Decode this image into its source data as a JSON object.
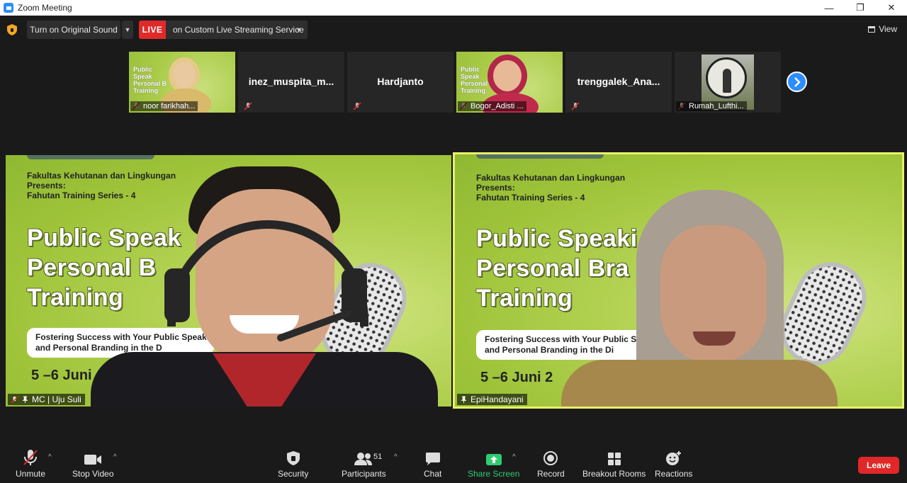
{
  "window": {
    "title": "Zoom Meeting",
    "controls": {
      "minimize": "—",
      "restore": "❐",
      "close": "✕"
    }
  },
  "topbar": {
    "sound_label": "Turn on Original Sound",
    "live_badge": "LIVE",
    "live_text": "on Custom Live Streaming Service",
    "view_label": "View"
  },
  "thumbnails": [
    {
      "name": "noor farikhah...",
      "type": "video"
    },
    {
      "name": "inez_muspita_m...",
      "type": "name"
    },
    {
      "name": "Hardjanto",
      "type": "name"
    },
    {
      "name": "Bogor_Adisti ...",
      "type": "video"
    },
    {
      "name": "trenggalek_Ana...",
      "type": "name"
    },
    {
      "name": "Rumah_Lufthi...",
      "type": "photo"
    }
  ],
  "slide": {
    "header_line1": "Fakultas Kehutanan dan Lingkungan",
    "header_line2": "Presents:",
    "header_line3": "Fahutan Training Series - 4",
    "mini_title": "Public Speak Personal B Training",
    "left_big1": "Public Speak",
    "left_big2": "Personal B",
    "left_big3": "Training",
    "left_bubble1": "Fostering Success with Your Public Speak",
    "left_bubble2": "and Personal Branding in the D",
    "left_date": "5 –6 Juni",
    "right_big1": "Public Speaki",
    "right_big2": "Personal Bra",
    "right_big3": "Training",
    "right_bubble1": "Fostering Success with Your Public Spe",
    "right_bubble2": "and Personal Branding in the Di",
    "right_date": "5 –6 Juni 2"
  },
  "tiles": {
    "left_name": "MC | Uju Suli",
    "right_name": "EpiHandayani"
  },
  "toolbar": {
    "unmute": "Unmute",
    "stop_video": "Stop Video",
    "security": "Security",
    "participants": "Participants",
    "participants_count": "51",
    "chat": "Chat",
    "share_screen": "Share Screen",
    "record": "Record",
    "breakout_rooms": "Breakout Rooms",
    "reactions": "Reactions",
    "leave": "Leave"
  },
  "colors": {
    "accent": "#2d8cff",
    "live_red": "#e02a2a",
    "share_green": "#2ecc71",
    "active_speaker": "#e9f26a",
    "slide_green": "#a9cb48"
  }
}
